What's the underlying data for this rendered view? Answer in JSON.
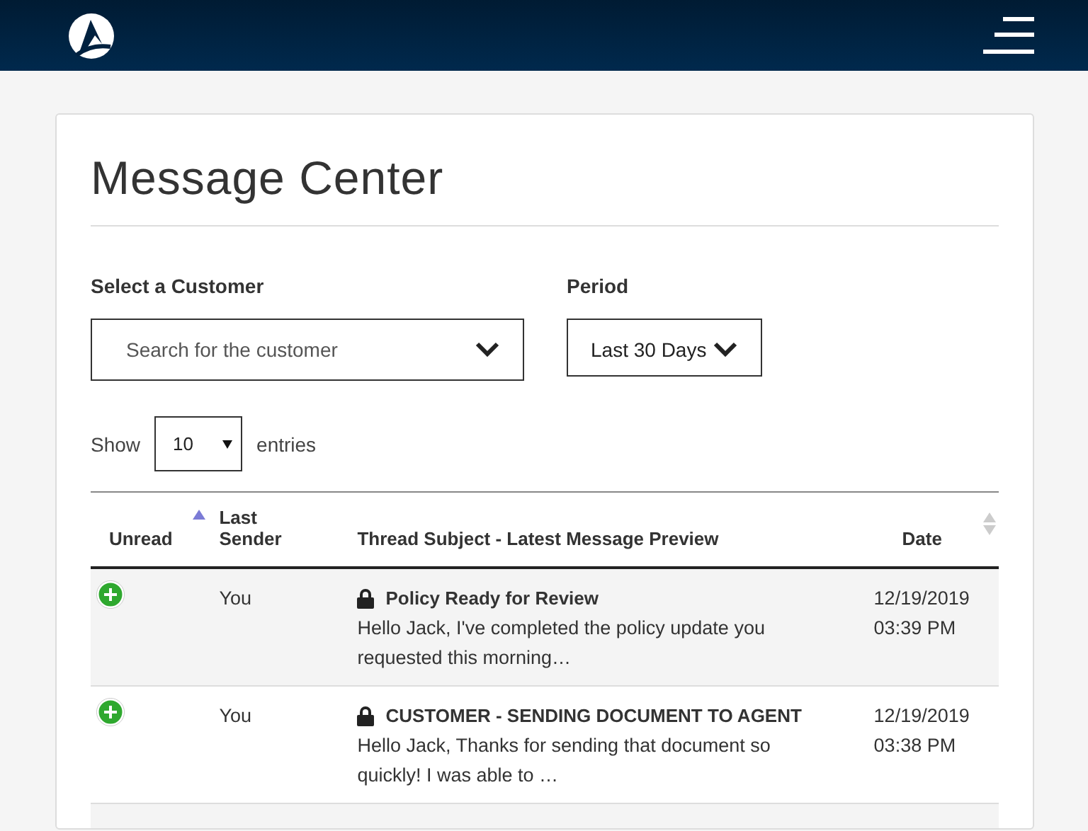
{
  "page_title": "Message Center",
  "customer_filter": {
    "label": "Select a Customer",
    "placeholder": "Search for the customer"
  },
  "period_filter": {
    "label": "Period",
    "value": "Last 30 Days"
  },
  "entries": {
    "prefix": "Show",
    "value": "10",
    "suffix": "entries"
  },
  "table": {
    "columns": [
      {
        "label": "Unread",
        "sorted": true
      },
      {
        "label": "Last Sender"
      },
      {
        "label": "Thread Subject - Latest Message Preview"
      },
      {
        "label": "Date",
        "sorted": false
      }
    ],
    "rows": [
      {
        "unread": true,
        "sender": "You",
        "locked": true,
        "subject": "Policy Ready for Review",
        "preview": "Hello Jack, I've completed the policy update you requested this morning…",
        "date": "12/19/2019",
        "time": "03:39 PM"
      },
      {
        "unread": true,
        "sender": "You",
        "locked": true,
        "subject": "CUSTOMER - SENDING DOCUMENT TO AGENT",
        "preview": "Hello Jack, Thanks for sending that document so quickly! I was able to …",
        "date": "12/19/2019",
        "time": "03:38 PM"
      }
    ]
  }
}
